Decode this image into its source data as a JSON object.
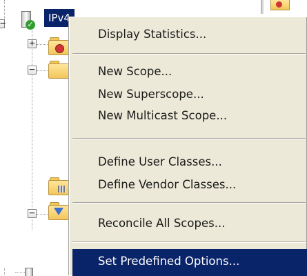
{
  "tree": {
    "selected_node_label": "IPv4",
    "expanders": [
      "−",
      "+",
      "−",
      "−"
    ]
  },
  "context_menu": {
    "items": [
      {
        "label": "Display Statistics..."
      },
      {
        "label": "New Scope..."
      },
      {
        "label": "New Superscope..."
      },
      {
        "label": "New Multicast Scope..."
      },
      {
        "label": "Define User Classes..."
      },
      {
        "label": "Define Vendor Classes..."
      },
      {
        "label": "Reconcile All Scopes..."
      },
      {
        "label": "Set Predefined Options..."
      }
    ],
    "highlighted_item": "Set Predefined Options..."
  },
  "colors": {
    "menu_background": "#ece9d8",
    "highlight_background": "#0a246a",
    "highlight_text": "#ffffff"
  },
  "icons": [
    "server-check-icon",
    "folder-icon",
    "scope-folder-icon",
    "filter-folder-icon",
    "server-options-icon"
  ]
}
